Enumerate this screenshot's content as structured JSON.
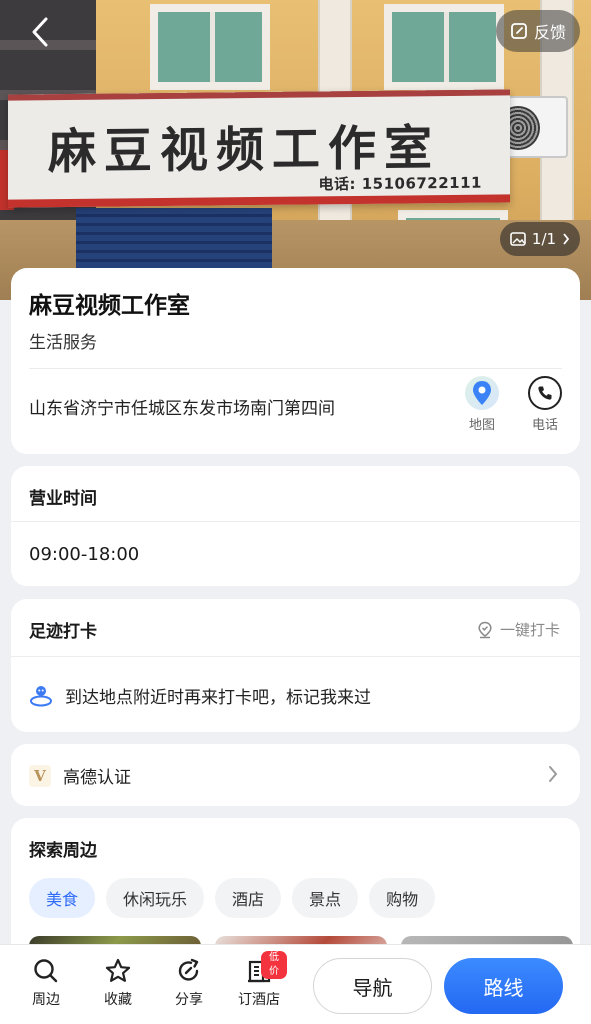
{
  "header": {
    "feedback_label": "反馈",
    "photo_counter": "1/1"
  },
  "photo": {
    "sign_text": "麻豆视频工作室",
    "sign_phone": "电话: 15106722111"
  },
  "poi": {
    "name": "麻豆视频工作室",
    "category": "生活服务",
    "address": "山东省济宁市任城区东发市场南门第四间",
    "actions": {
      "map_label": "地图",
      "phone_label": "电话"
    }
  },
  "hours": {
    "title": "营业时间",
    "value": "09:00-18:00"
  },
  "checkin": {
    "title": "足迹打卡",
    "button_label": "一键打卡",
    "tip": "到达地点附近时再来打卡吧，标记我来过"
  },
  "verification": {
    "badge": "V",
    "label": "高德认证"
  },
  "explore": {
    "title": "探索周边",
    "chips": [
      "美食",
      "休闲玩乐",
      "酒店",
      "景点",
      "购物"
    ],
    "active_chip": "美食"
  },
  "bottom_bar": {
    "tabs": {
      "around": "周边",
      "favorite": "收藏",
      "share": "分享",
      "hotel": "订酒店"
    },
    "hotel_badge": "低价",
    "navigate_label": "导航",
    "route_label": "路线"
  },
  "colors": {
    "accent": "#2f6cf6",
    "route_button": "#2468f2",
    "sign_red": "#c3322c",
    "badge_red": "#f3343f"
  }
}
